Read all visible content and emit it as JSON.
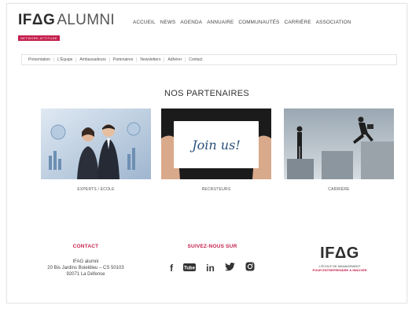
{
  "logo": {
    "ifag": "IFΔG",
    "alumni": "ALUMNI",
    "tagline": "NETWORK ATTITUDE"
  },
  "mainnav": [
    "ACCUEIL",
    "NEWS",
    "AGENDA",
    "ANNUAIRE",
    "COMMUNAUTÉS",
    "CARRIÈRE",
    "ASSOCIATION"
  ],
  "subnav": [
    "Présentation",
    "L'Équipe",
    "Ambassadeurs",
    "Partenaires",
    "Newsletters",
    "Adhérer",
    "Contact"
  ],
  "page_title": "NOS PARTENAIRES",
  "cards": [
    {
      "caption": "EXPERTS / ÉCOLE"
    },
    {
      "caption": "RECRUTEURS",
      "sign_text": "Join us!"
    },
    {
      "caption": "CARRIÈRE"
    }
  ],
  "footer": {
    "contact_title": "CONTACT",
    "address_lines": [
      "IFAG alumni",
      "20 Bis Jardins Boieldieu – CS 50103",
      "92071 La Défense"
    ],
    "social_title": "SUIVEZ-NOUS SUR",
    "social_icons": [
      "facebook-icon",
      "youtube-icon",
      "linkedin-icon",
      "twitter-icon",
      "instagram-icon"
    ],
    "ifag_logo": "IFΔG",
    "ifag_tagline1": "L'ÉCOLE DE MANAGEMENT",
    "ifag_tagline2": "POUR ENTREPRENDRE & INNOVER"
  },
  "colors": {
    "accent": "#c41f4e",
    "text": "#333333"
  }
}
